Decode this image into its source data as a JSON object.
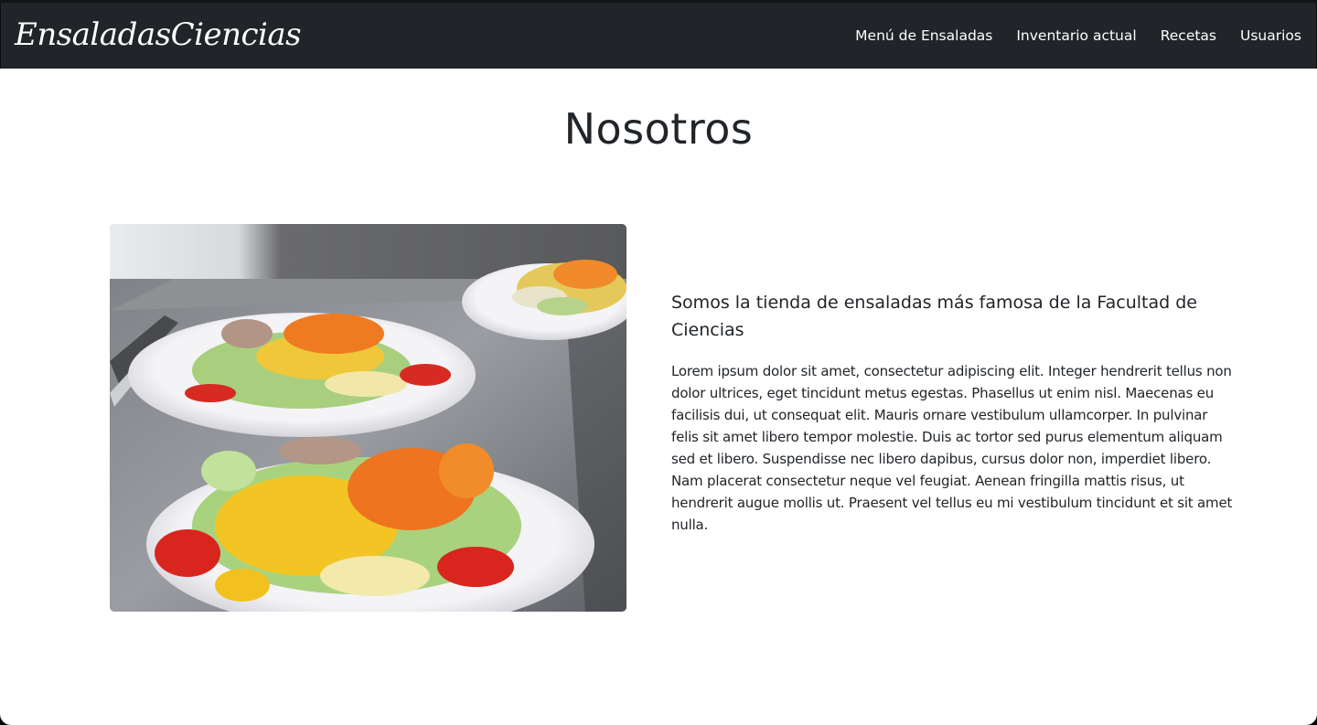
{
  "navbar": {
    "brand": "EnsaladasCiencias",
    "links": [
      {
        "label": "Menú de Ensaladas"
      },
      {
        "label": "Inventario actual"
      },
      {
        "label": "Recetas"
      },
      {
        "label": "Usuarios"
      }
    ]
  },
  "main": {
    "title": "Nosotros",
    "lead": "Somos la tienda de ensaladas más famosa de la Facultad de Ciencias",
    "body": "Lorem ipsum dolor sit amet, consectetur adipiscing elit. Integer hendrerit tellus non dolor ultrices, eget tincidunt metus egestas. Phasellus ut enim nisl. Maecenas eu facilisis dui, ut consequat elit. Mauris ornare vestibulum ullamcorper. In pulvinar felis sit amet libero tempor molestie. Duis ac tortor sed purus elementum aliquam sed et libero. Suspendisse nec libero dapibus, cursus dolor non, imperdiet libero. Nam placerat consectetur neque vel feugiat. Aenean fringilla mattis risus, ut hendrerit augue mollis ut. Praesent vel tellus eu mi vestibulum tincidunt et sit amet nulla."
  },
  "colors": {
    "navbar_bg": "#212529",
    "text": "#212529",
    "page_bg": "#ffffff"
  }
}
